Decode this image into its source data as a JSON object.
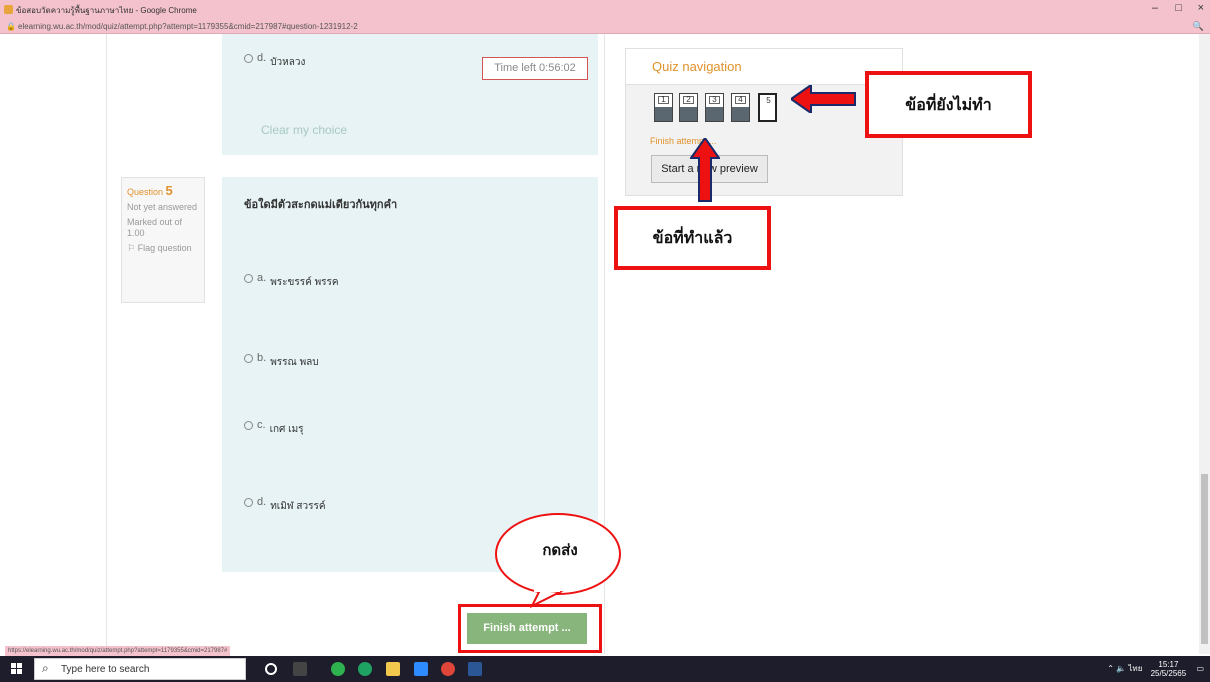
{
  "browser": {
    "window_title": "ข้อสอบวัดความรู้พื้นฐานภาษาไทย - Google Chrome",
    "url": "elearning.wu.ac.th/mod/quiz/attempt.php?attempt=1179355&cmid=217987#question-1231912-2",
    "status_url": "https://elearning.wu.ac.th/mod/quiz/attempt.php?attempt=1179355&cmid=217987#",
    "minimize": "–",
    "maximize": "□",
    "close": "×",
    "zoom": "🔍"
  },
  "question4": {
    "option_d_letter": "d.",
    "option_d_text": "บัวหลวง",
    "time_left": "Time left 0:56:02",
    "clear_choice": "Clear my choice"
  },
  "question5": {
    "label": "Question",
    "number": "5",
    "status": "Not yet answered",
    "marked": "Marked out of 1.00",
    "flag": "Flag question",
    "text": "ข้อใดมีตัวสะกดแม่เดียวกันทุกคำ",
    "options": [
      {
        "letter": "a.",
        "text": "พระขรรค์ พรรค"
      },
      {
        "letter": "b.",
        "text": "พรรณ พลบ"
      },
      {
        "letter": "c.",
        "text": "เกศ เมรุ"
      },
      {
        "letter": "d.",
        "text": "ทเมิฬ สวรรค์"
      }
    ]
  },
  "quiz_nav": {
    "title": "Quiz navigation",
    "buttons": [
      "1",
      "2",
      "3",
      "4",
      "5"
    ],
    "finish_link": "Finish attempt ...",
    "preview_button": "Start a new preview"
  },
  "annotations": {
    "not_done": "ข้อที่ยังไม่ทำ",
    "done": "ข้อที่ทำแล้ว",
    "submit": "กดส่ง"
  },
  "finish_button": "Finish attempt ...",
  "taskbar": {
    "search_placeholder": "Type here to search",
    "time": "15:17",
    "date": "25/5/2565",
    "lang": "ไทย"
  },
  "colors": {
    "accent": "#e0922c",
    "annotation_red": "#ee1111",
    "card_bg": "#e7f3f5",
    "finish_green": "#87b57b",
    "chrome_pink": "#f4c2cd"
  }
}
